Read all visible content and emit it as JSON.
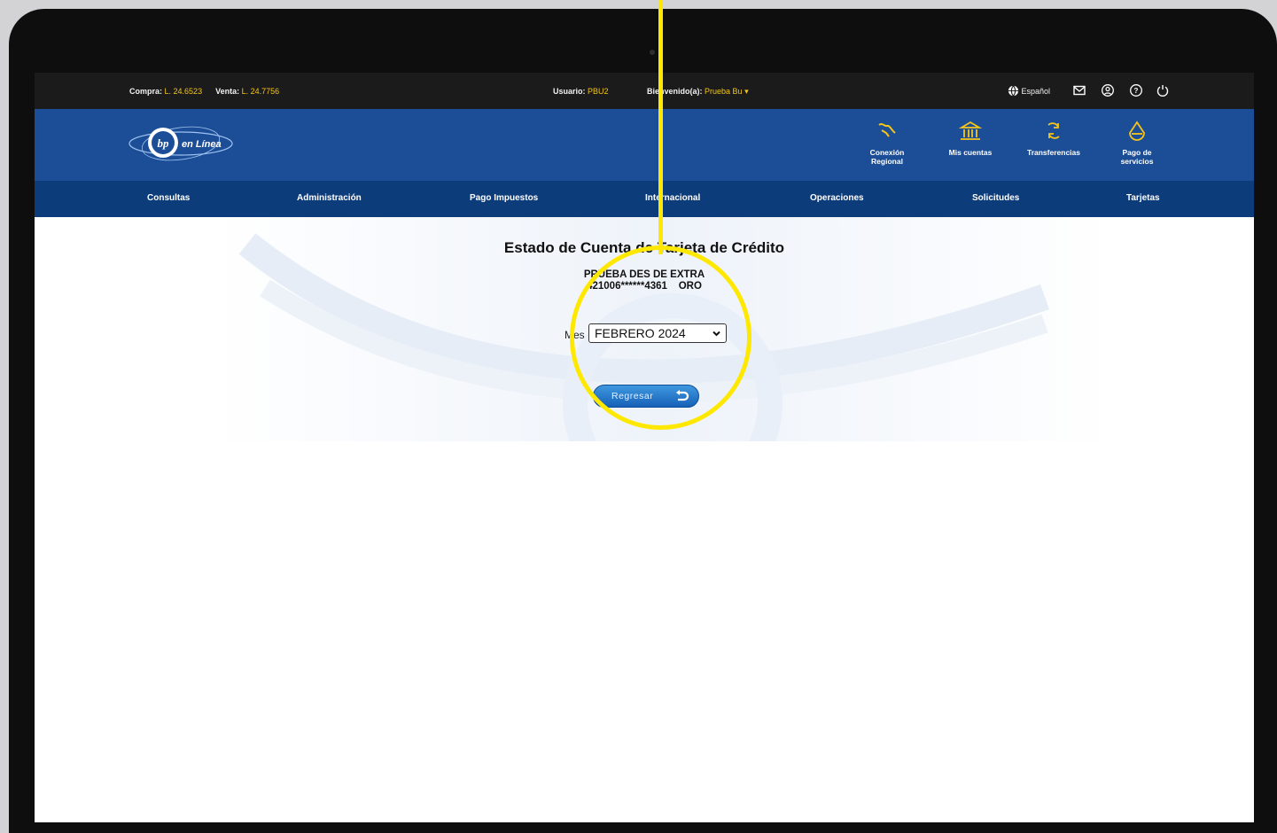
{
  "topbar": {
    "compra_label": "Compra:",
    "compra_value": "L. 24.6523",
    "venta_label": "Venta:",
    "venta_value": "L. 24.7756",
    "usuario_label": "Usuario:",
    "usuario_value": "PBU2",
    "bienvenido_label": "Bienvenido(a):",
    "bienvenido_value": "Prueba Bu",
    "language": "Español"
  },
  "header": {
    "logo_text": "en Línea",
    "quick_links": [
      {
        "line1": "Conexión",
        "line2": "Regional",
        "icon": "map-icon"
      },
      {
        "line1": "Mis cuentas",
        "line2": "",
        "icon": "bank-icon"
      },
      {
        "line1": "Transferencias",
        "line2": "",
        "icon": "transfer-icon"
      },
      {
        "line1": "Pago de",
        "line2": "servicios",
        "icon": "pay-icon"
      }
    ]
  },
  "nav": {
    "items": [
      "Consultas",
      "Administración",
      "Pago Impuestos",
      "Internacional",
      "Operaciones",
      "Solicitudes",
      "Tarjetas"
    ]
  },
  "content": {
    "title": "Estado de Cuenta de Tarjeta de Crédito",
    "holder_name": "PRUEBA DES DE EXTRA",
    "card_number": "421006******4361",
    "card_type": "ORO",
    "mes_label": "Mes",
    "mes_value": "FEBRERO 2024",
    "back_button": "Regresar"
  },
  "colors": {
    "accent": "#f5c518",
    "header_blue": "#1c4e98",
    "nav_blue": "#0d3c7b",
    "annotation": "#ffe800"
  }
}
